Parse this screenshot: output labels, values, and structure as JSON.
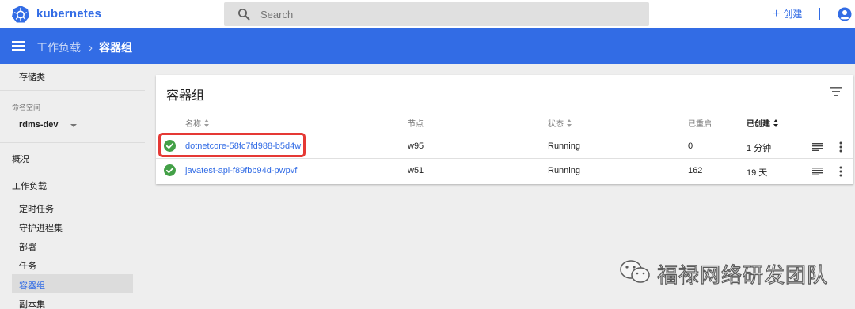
{
  "app": {
    "brand": "kubernetes",
    "create_label": "创建",
    "create_symbol": "+"
  },
  "search": {
    "placeholder": "Search"
  },
  "breadcrumb": {
    "parent": "工作负载",
    "separator": "›",
    "current": "容器组"
  },
  "sidebar": {
    "storage_class": "存储类",
    "namespace_label": "命名空间",
    "namespace_value": "rdms-dev",
    "overview": "概况",
    "workloads": "工作负载",
    "items": [
      {
        "label": "定时任务"
      },
      {
        "label": "守护进程集"
      },
      {
        "label": "部署"
      },
      {
        "label": "任务"
      },
      {
        "label": "容器组",
        "active": true
      },
      {
        "label": "副本集"
      }
    ]
  },
  "card": {
    "title": "容器组",
    "columns": {
      "name": "名称",
      "node": "节点",
      "status": "状态",
      "restarts": "已重启",
      "created": "已创建"
    },
    "rows": [
      {
        "name": "dotnetcore-58fc7fd988-b5d4w",
        "node": "w95",
        "status": "Running",
        "restarts": "0",
        "created": "1 分钟",
        "highlighted": true
      },
      {
        "name": "javatest-api-f89fbb94d-pwpvf",
        "node": "w51",
        "status": "Running",
        "restarts": "162",
        "created": "19 天",
        "highlighted": false
      }
    ]
  },
  "watermark": {
    "text": "福禄网络研发团队"
  },
  "colors": {
    "brand_blue": "#326ce5",
    "status_ok": "#43a047",
    "highlight_red": "#e53935"
  },
  "icons": [
    "kubernetes-logo",
    "search-icon",
    "plus-icon",
    "account-icon",
    "menu-icon",
    "filter-icon",
    "check-circle-icon",
    "logs-icon",
    "more-vert-icon",
    "wechat-icon"
  ]
}
